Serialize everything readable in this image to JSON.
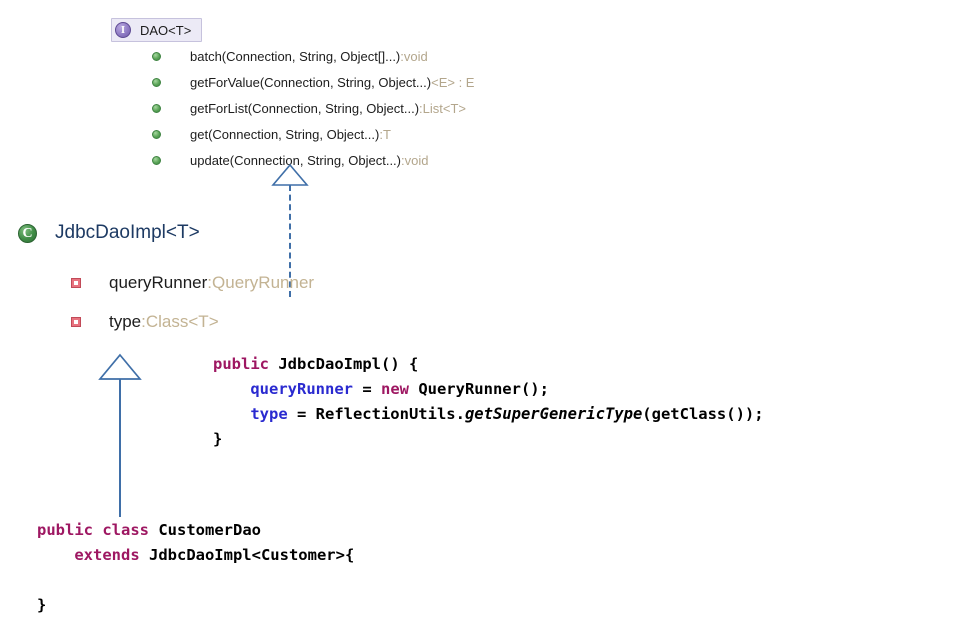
{
  "diagram": {
    "interface": {
      "icon": "interface-icon",
      "icon_glyph": "I",
      "name": "DAO<T>",
      "members": [
        {
          "icon": "public-method-icon",
          "signature": "batch(Connection, String, Object[]...)",
          "separator": " : ",
          "return_type": "void"
        },
        {
          "icon": "public-method-icon",
          "signature": "getForValue(Connection, String, Object...)",
          "separator": " ",
          "return_type": "<E> : E"
        },
        {
          "icon": "public-method-icon",
          "signature": "getForList(Connection, String, Object...)",
          "separator": " : ",
          "return_type": "List<T>"
        },
        {
          "icon": "public-method-icon",
          "signature": "get(Connection, String, Object...)",
          "separator": " : ",
          "return_type": "T"
        },
        {
          "icon": "public-method-icon",
          "signature": "update(Connection, String, Object...)",
          "separator": " : ",
          "return_type": "void"
        }
      ]
    },
    "class": {
      "icon": "class-icon",
      "icon_glyph": "C",
      "name": "JdbcDaoImpl<T>",
      "fields": [
        {
          "icon": "private-field-icon",
          "name": "queryRunner",
          "separator": " : ",
          "type": "QueryRunner"
        },
        {
          "icon": "private-field-icon",
          "name": "type",
          "separator": " : ",
          "type": "Class<T>"
        }
      ]
    },
    "relations": [
      {
        "name": "realization-dao-jdbcdaoimpl",
        "style": "dashed",
        "arrow": "hollow-triangle"
      },
      {
        "name": "generalization-jdbcdaoimpl-customerdao",
        "style": "solid",
        "arrow": "hollow-triangle"
      }
    ]
  },
  "code_constructor": {
    "name": "jdbc-dao-impl-constructor",
    "lines": [
      [
        {
          "t": "public",
          "c": "kw"
        },
        {
          "t": " JdbcDaoImpl() {",
          "c": "plain"
        }
      ],
      [
        {
          "t": "    ",
          "c": "plain"
        },
        {
          "t": "queryRunner",
          "c": "fld"
        },
        {
          "t": " = ",
          "c": "plain"
        },
        {
          "t": "new",
          "c": "kw"
        },
        {
          "t": " QueryRunner();",
          "c": "plain"
        }
      ],
      [
        {
          "t": "    ",
          "c": "plain"
        },
        {
          "t": "type",
          "c": "fld"
        },
        {
          "t": " = ReflectionUtils.",
          "c": "plain"
        },
        {
          "t": "getSuperGenericType",
          "c": "ital"
        },
        {
          "t": "(getClass());",
          "c": "plain"
        }
      ],
      [
        {
          "t": "}",
          "c": "plain"
        }
      ]
    ]
  },
  "code_customer_dao": {
    "name": "customer-dao-declaration",
    "lines": [
      [
        {
          "t": "public",
          "c": "kw"
        },
        {
          "t": " ",
          "c": "plain"
        },
        {
          "t": "class",
          "c": "kw"
        },
        {
          "t": " CustomerDao",
          "c": "plain"
        }
      ],
      [
        {
          "t": "    ",
          "c": "plain"
        },
        {
          "t": "extends",
          "c": "kw"
        },
        {
          "t": " JdbcDaoImpl<Customer>{",
          "c": "plain"
        }
      ],
      [
        {
          "t": "",
          "c": "plain"
        }
      ],
      [
        {
          "t": "}",
          "c": "plain"
        }
      ]
    ]
  },
  "colors": {
    "accent_line": "#3f6fa8",
    "interface_icon": "#7f6ab5",
    "class_icon": "#3f8c46",
    "method_icon": "#5ba558",
    "field_icon": "#e8737f",
    "keyword": "#9e1762",
    "field_ref": "#2a2ad0",
    "type_muted": "#b3a68c",
    "class_title": "#1d3a63"
  }
}
